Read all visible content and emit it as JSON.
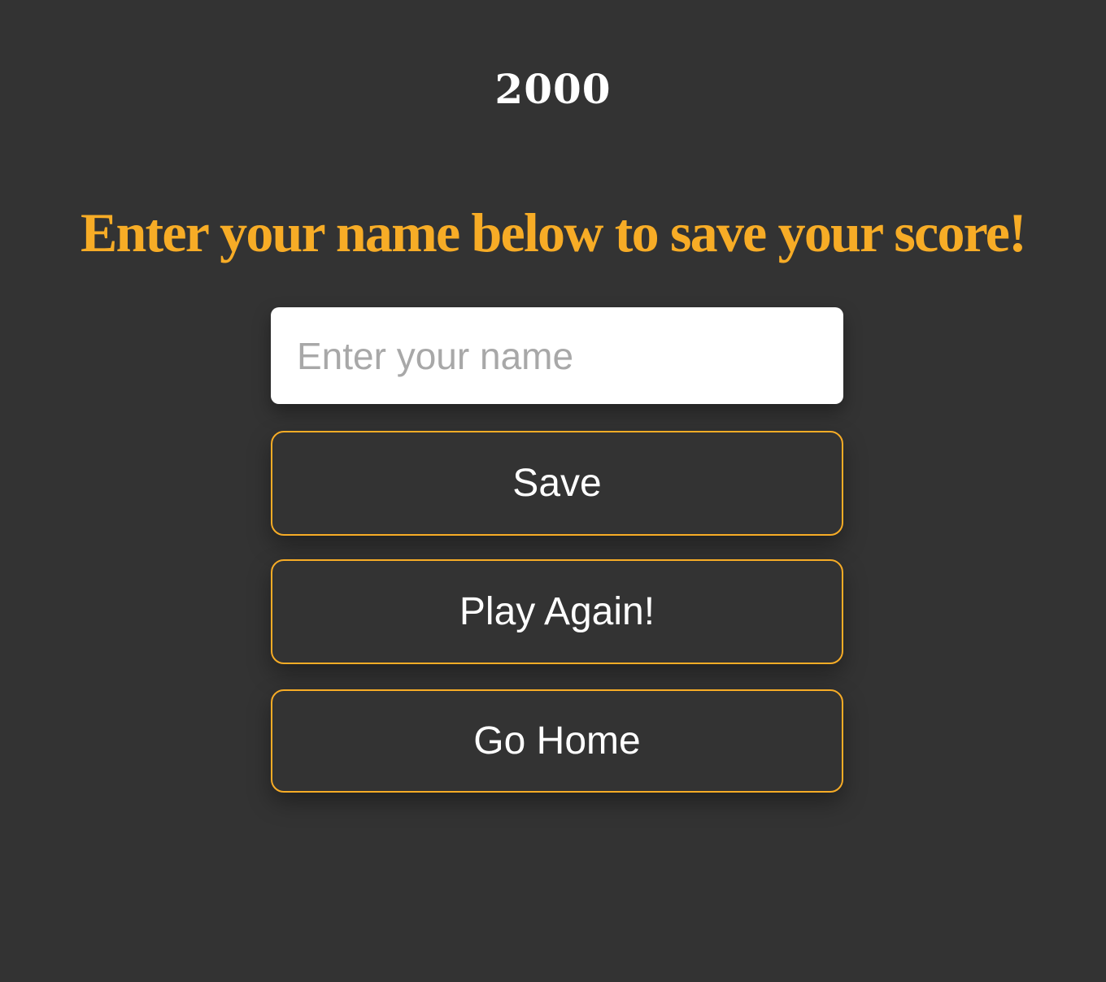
{
  "score": "2000",
  "heading": "Enter your name below to save your score!",
  "form": {
    "name_placeholder": "Enter your name",
    "name_value": ""
  },
  "buttons": {
    "save": "Save",
    "play_again": "Play Again!",
    "go_home": "Go Home"
  },
  "colors": {
    "background": "#333333",
    "accent": "#f7ac26",
    "text": "#ffffff",
    "input_background": "#ffffff",
    "placeholder": "#a8a8a8"
  }
}
